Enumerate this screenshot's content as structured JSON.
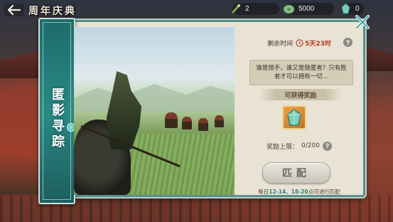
{
  "header": {
    "title": "周年庆典",
    "back_icon": "back-arrow-icon"
  },
  "resources": [
    {
      "icon": "horn-icon",
      "value": "2"
    },
    {
      "icon": "coin-icon",
      "value": "5000"
    },
    {
      "icon": "jade-icon",
      "value": "0"
    }
  ],
  "banner": {
    "title": "匿影寻踪"
  },
  "info": {
    "time_label": "剩余时间",
    "time_value": "5天23时",
    "quote": "谁是猎手，谁又是隐匿者？只有胜者才可以拥有一切…",
    "reward_title": "可获得奖励",
    "limit_label": "奖励上限：",
    "limit_value": "0/200",
    "match_button": "匹配",
    "schedule_prefix": "每日",
    "schedule_times": "12-14、18-20",
    "schedule_suffix": "点可进行匹配"
  },
  "colors": {
    "accent_teal": "#2b8a85",
    "time_red": "#b23a22"
  }
}
